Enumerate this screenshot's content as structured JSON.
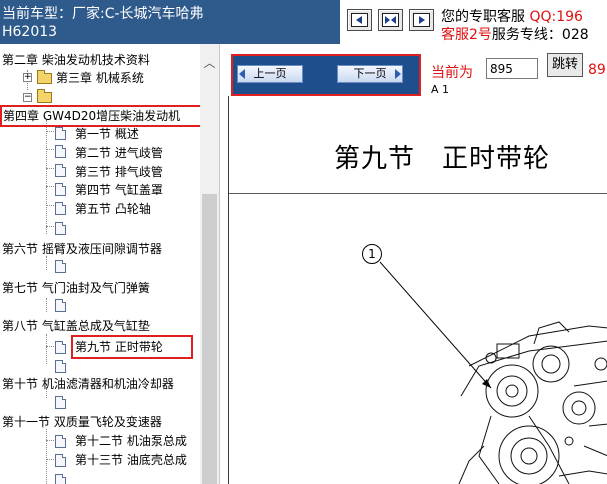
{
  "header": {
    "vehicle_line1": "当前车型：厂家:C-长城汽车哈弗",
    "vehicle_line2": "H62013",
    "service_line1_a": "您的专职客服",
    "service_line1_b": "QQ:196",
    "service_line2_a": "客服2号",
    "service_line2_b": "服务专线：028"
  },
  "toolbar_icons": [
    "previous-page-icon",
    "fit-page-icon",
    "next-page-icon"
  ],
  "tree": {
    "items": [
      {
        "label": "第二章 柴油发动机技术资料"
      },
      {
        "label": "第三章 机械系统"
      },
      {
        "label": ""
      },
      {
        "label": "第四章 GW4D20增压柴油发动机"
      },
      {
        "label": "第一节 概述"
      },
      {
        "label": "第二节 进气歧管"
      },
      {
        "label": "第三节 排气歧管"
      },
      {
        "label": "第四节 气缸盖罩"
      },
      {
        "label": "第五节 凸轮轴"
      },
      {
        "label": "第六节 摇臂及液压间隙调节器"
      },
      {
        "label": "第七节 气门油封及气门弹簧"
      },
      {
        "label": "第八节 气缸盖总成及气缸垫"
      },
      {
        "label": "第九节 正时带轮"
      },
      {
        "label": "第十节 机油滤清器和机油冷却器"
      },
      {
        "label": "第十一节 双质量飞轮及变速器"
      },
      {
        "label": "第十二节 机油泵总成"
      },
      {
        "label": "第十三节 油底壳总成"
      }
    ]
  },
  "nav": {
    "prev_label": "上一页",
    "next_label": "下一页",
    "current_label": "当前为",
    "page_value": "895",
    "jump_label": "跳转",
    "trailing_text": "89",
    "sub_text": "A 1"
  },
  "document": {
    "title": "第九节　正时带轮",
    "callout": "1"
  }
}
